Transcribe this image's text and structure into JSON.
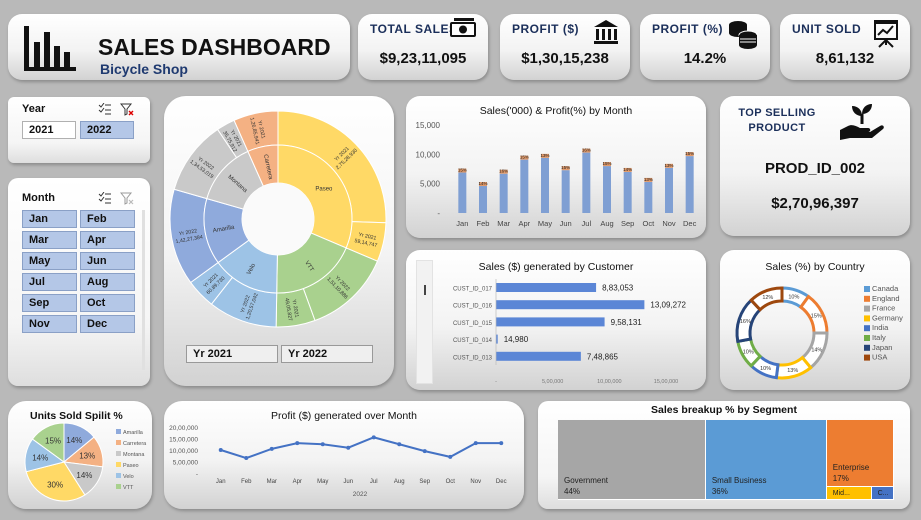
{
  "header": {
    "title": "SALES DASHBOARD",
    "subtitle": "Bicycle Shop"
  },
  "kpis": {
    "total_sales": {
      "label": "TOTAL SALES",
      "value": "$9,23,11,095"
    },
    "profit": {
      "label": "PROFIT ($)",
      "value": "$1,30,15,238"
    },
    "profit_pct": {
      "label": "PROFIT (%)",
      "value": "14.2%"
    },
    "units_sold": {
      "label": "UNIT SOLD",
      "value": "8,61,132"
    }
  },
  "year_slicer": {
    "label": "Year",
    "options": [
      "2021",
      "2022"
    ],
    "selected": "2022"
  },
  "month_slicer": {
    "label": "Month",
    "options": [
      "Jan",
      "Feb",
      "Mar",
      "Apr",
      "May",
      "Jun",
      "Jul",
      "Aug",
      "Sep",
      "Oct",
      "Nov",
      "Dec"
    ]
  },
  "sunburst": {
    "buttons": [
      "Yr 2021",
      "Yr 2022"
    ],
    "outer_labels": [
      "Yr 2021 2,75,28,930",
      "Yr 2021 59,14,747",
      "Yr 2022 1,51,10,886",
      "Yr 2021 49,05,827",
      "Yr 2022 1,20,57,042",
      "Yr 2021 60,89,730",
      "Yr 2022 1,42,27,384",
      "Yr 2022 1,34,53,019",
      "Yr 2021 35,75,912",
      "Yr 2021 1,26,85,941"
    ],
    "inner_labels": [
      "Paseo",
      "VTT",
      "Velo",
      "Amarilla",
      "Montana",
      "Carretera"
    ]
  },
  "top_product": {
    "label": "TOP SELLING PRODUCT",
    "product": "PROD_ID_002",
    "value": "$2,70,96,397"
  },
  "chart_data": [
    {
      "id": "sales_profit_month",
      "type": "bar",
      "title": "Sales('000) & Profit(%) by Month",
      "categories": [
        "Jan",
        "Feb",
        "Mar",
        "Apr",
        "May",
        "Jun",
        "Jul",
        "Aug",
        "Sep",
        "Oct",
        "Nov",
        "Dec"
      ],
      "series": [
        {
          "name": "Sales('000)",
          "values": [
            6900,
            4600,
            6700,
            9100,
            9400,
            7300,
            10300,
            8000,
            7000,
            5300,
            7700,
            9700
          ]
        },
        {
          "name": "Profit(%)",
          "values": [
            15,
            14,
            16,
            15,
            13,
            15,
            16,
            15,
            14,
            13,
            13,
            15
          ]
        }
      ],
      "data_labels": [
        "15%",
        "14%",
        "16%",
        "15%",
        "13%",
        "15%",
        "16%",
        "15%",
        "14%",
        "13%",
        "13%",
        "15%"
      ],
      "ylim": [
        0,
        15000
      ],
      "y_ticks": [
        "15,000",
        "10,000",
        "5,000",
        "-"
      ]
    },
    {
      "id": "sales_by_customer",
      "type": "bar",
      "title": "Sales ($) generated by Customer",
      "categories": [
        "CUST_ID_017",
        "CUST_ID_016",
        "CUST_ID_015",
        "CUST_ID_014",
        "CUST_ID_013"
      ],
      "values": [
        883053,
        1309272,
        958131,
        14980,
        748865
      ],
      "value_labels": [
        "8,83,053",
        "13,09,272",
        "9,58,131",
        "14,980",
        "7,48,865"
      ],
      "xlim": [
        0,
        1500000
      ],
      "x_ticks": [
        "-",
        "5,00,000",
        "10,00,000",
        "15,00,000"
      ]
    },
    {
      "id": "sales_by_country",
      "type": "pie",
      "title": "Sales (%) by Country",
      "categories": [
        "Canada",
        "England",
        "France",
        "Germany",
        "India",
        "Italy",
        "Japan",
        "USA"
      ],
      "values": [
        10,
        15,
        14,
        13,
        10,
        10,
        16,
        12
      ],
      "labels": [
        "10%",
        "15%",
        "14%",
        "13%",
        "10%",
        "10%",
        "16%",
        "12%"
      ],
      "colors": [
        "#5b9bd5",
        "#ed7d31",
        "#a5a5a5",
        "#ffc000",
        "#4472c4",
        "#70ad47",
        "#264478",
        "#9e480e"
      ]
    },
    {
      "id": "units_sold_split",
      "type": "pie",
      "title": "Units Sold Spilit %",
      "categories": [
        "Amarilla",
        "Carretera",
        "Montana",
        "Paseo",
        "Velo",
        "VTT"
      ],
      "values": [
        14,
        13,
        14,
        30,
        14,
        15
      ],
      "labels": [
        "14%",
        "13%",
        "14%",
        "30%",
        "14%",
        "15%"
      ],
      "colors": [
        "#8faadc",
        "#f4b183",
        "#c9c9c9",
        "#ffd966",
        "#9dc3e6",
        "#a9d18e"
      ]
    },
    {
      "id": "profit_over_month",
      "type": "line",
      "title": "Profit ($) generated over Month",
      "categories": [
        "Jan",
        "Feb",
        "Mar",
        "Apr",
        "May",
        "Jun",
        "Jul",
        "Aug",
        "Sep",
        "Oct",
        "Nov",
        "Dec"
      ],
      "values": [
        1000000,
        650000,
        1050000,
        1300000,
        1250000,
        1100000,
        1550000,
        1250000,
        950000,
        700000,
        1300000,
        1300000
      ],
      "ylim": [
        0,
        2000000
      ],
      "y_ticks": [
        "20,00,000",
        "15,00,000",
        "10,00,000",
        "5,00,000",
        "-"
      ],
      "xlabel": "2022"
    },
    {
      "id": "sales_by_segment",
      "type": "treemap",
      "title": "Sales breakup % by Segment",
      "categories": [
        "Government",
        "Small Business",
        "Enterprise",
        "Mid...",
        "C..."
      ],
      "values": [
        44,
        36,
        17,
        2,
        1
      ],
      "labels": [
        "44%",
        "36%",
        "17%",
        "",
        ""
      ],
      "colors": [
        "#a6a6a6",
        "#5b9bd5",
        "#ed7d31",
        "#ffc000",
        "#4472c4"
      ]
    }
  ]
}
